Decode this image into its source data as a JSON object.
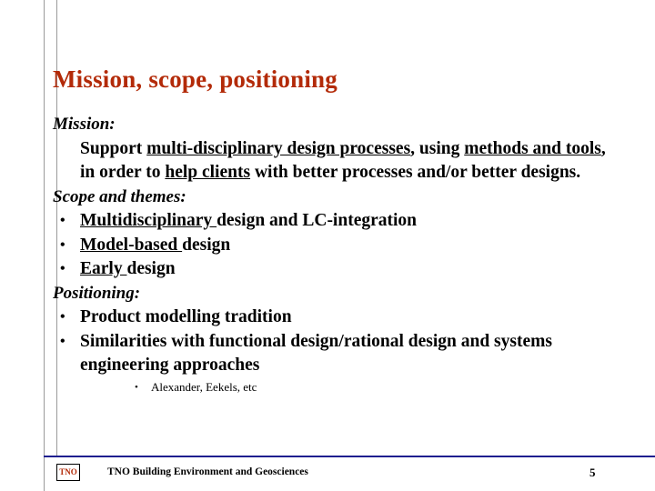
{
  "slide": {
    "title": "Mission, scope, positioning",
    "sections": {
      "mission_heading": "Mission:",
      "mission_text": {
        "p1": "Support ",
        "u1": "multi-disciplinary design processes",
        "p2": ", using ",
        "u2": "methods and tools",
        "p3": ", in order to ",
        "u3": "help clients",
        "p4": " with better processes and/or better designs."
      },
      "scope_heading": "Scope and themes:",
      "scope_items": [
        {
          "underlined": "Multidisciplinary ",
          "rest": "design and LC-integration"
        },
        {
          "underlined": "Model-based ",
          "rest": "design"
        },
        {
          "underlined": "Early ",
          "rest": "design"
        }
      ],
      "positioning_heading": "Positioning:",
      "positioning_items": [
        "Product modelling tradition",
        "Similarities with functional design/rational design and systems engineering approaches"
      ],
      "sub_item": "Alexander, Eekels, etc"
    },
    "bullet_glyph": "•",
    "footer": {
      "logo_text": "TNO",
      "text": "TNO Building Environment and Geosciences",
      "page_number": "5"
    },
    "colors": {
      "title": "#b32a08",
      "footer_rule": "#1f1f8f",
      "text": "#000000"
    }
  }
}
